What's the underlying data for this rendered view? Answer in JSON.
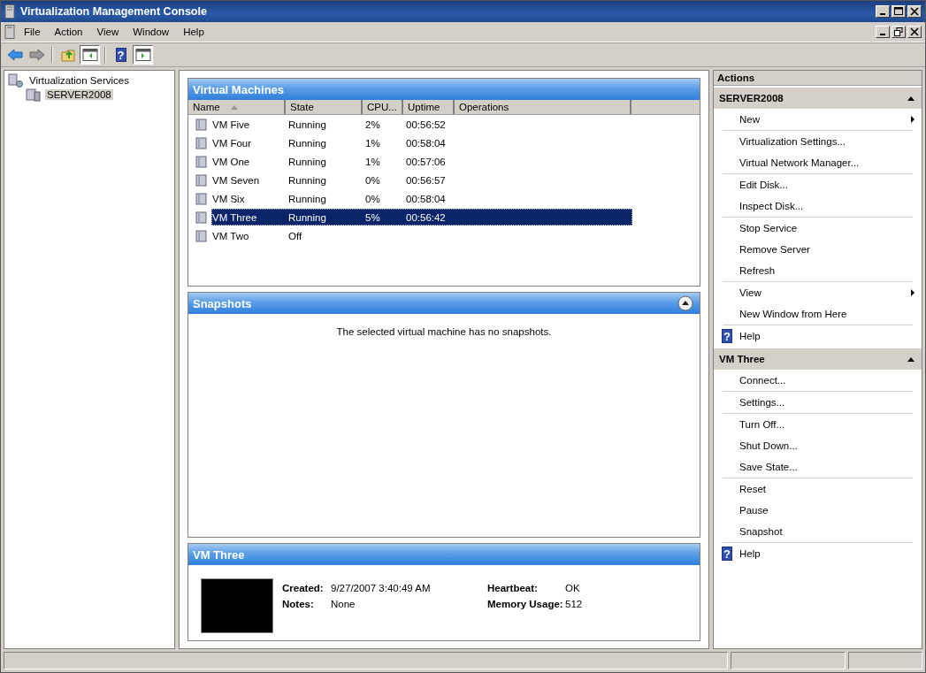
{
  "window": {
    "title": "Virtualization Management Console"
  },
  "menu": [
    {
      "label": "File"
    },
    {
      "label": "Action"
    },
    {
      "label": "View"
    },
    {
      "label": "Window"
    },
    {
      "label": "Help"
    }
  ],
  "toolbar": [
    {
      "kind": "back",
      "pressed": false
    },
    {
      "kind": "forward",
      "pressed": false
    },
    {
      "kind": "separator"
    },
    {
      "kind": "up",
      "pressed": false
    },
    {
      "kind": "tree",
      "pressed": true
    },
    {
      "kind": "separator"
    },
    {
      "kind": "help",
      "pressed": false,
      "glyph": "?"
    },
    {
      "kind": "actionpane",
      "pressed": true
    }
  ],
  "tree": [
    {
      "label": "Virtualization Services",
      "selected": false,
      "children": [
        {
          "label": "SERVER2008",
          "selected": true
        }
      ]
    }
  ],
  "virtual_machines": {
    "title": "Virtual Machines",
    "columns": [
      "Name",
      "State",
      "CPU...",
      "Uptime",
      "Operations"
    ],
    "rows": [
      {
        "name": "VM Five",
        "state": "Running",
        "cpu": "2%",
        "uptime": "00:56:52",
        "selected": false
      },
      {
        "name": "VM Four",
        "state": "Running",
        "cpu": "1%",
        "uptime": "00:58:04",
        "selected": false
      },
      {
        "name": "VM One",
        "state": "Running",
        "cpu": "1%",
        "uptime": "00:57:06",
        "selected": false
      },
      {
        "name": "VM Seven",
        "state": "Running",
        "cpu": "0%",
        "uptime": "00:56:57",
        "selected": false
      },
      {
        "name": "VM Six",
        "state": "Running",
        "cpu": "0%",
        "uptime": "00:58:04",
        "selected": false
      },
      {
        "name": "VM Three",
        "state": "Running",
        "cpu": "5%",
        "uptime": "00:56:42",
        "selected": true
      },
      {
        "name": "VM Two",
        "state": "Off",
        "cpu": "",
        "uptime": "",
        "selected": false
      }
    ]
  },
  "snapshots": {
    "title": "Snapshots",
    "message": "The selected virtual machine has no snapshots."
  },
  "details": {
    "title": "VM Three",
    "fields": [
      {
        "label": "Created:",
        "value": "9/27/2007 3:40:49 AM"
      },
      {
        "label": "Heartbeat:",
        "value": "OK"
      },
      {
        "label": "Notes:",
        "value": "None"
      },
      {
        "label": "Memory Usage:",
        "value": "512"
      }
    ]
  },
  "actions": {
    "title": "Actions",
    "sections": [
      {
        "title": "SERVER2008",
        "expanded": true,
        "groups": [
          [
            {
              "label": "New",
              "kind": "submenu"
            }
          ],
          [
            {
              "label": "Virtualization Settings...",
              "kind": "plain"
            },
            {
              "label": "Virtual Network Manager...",
              "kind": "plain"
            }
          ],
          [
            {
              "label": "Edit Disk...",
              "kind": "plain"
            },
            {
              "label": "Inspect Disk...",
              "kind": "plain"
            }
          ],
          [
            {
              "label": "Stop Service",
              "kind": "plain"
            },
            {
              "label": "Remove Server",
              "kind": "plain"
            },
            {
              "label": "Refresh",
              "kind": "plain"
            }
          ],
          [
            {
              "label": "View",
              "kind": "submenu"
            },
            {
              "label": "New Window from Here",
              "kind": "plain"
            }
          ],
          [
            {
              "label": "Help",
              "kind": "help",
              "glyph": "?"
            }
          ]
        ]
      },
      {
        "title": "VM Three",
        "expanded": true,
        "groups": [
          [
            {
              "label": "Connect...",
              "kind": "plain"
            }
          ],
          [
            {
              "label": "Settings...",
              "kind": "plain"
            }
          ],
          [
            {
              "label": "Turn Off...",
              "kind": "plain"
            },
            {
              "label": "Shut Down...",
              "kind": "plain"
            },
            {
              "label": "Save State...",
              "kind": "plain"
            }
          ],
          [
            {
              "label": "Reset",
              "kind": "plain"
            },
            {
              "label": "Pause",
              "kind": "plain"
            },
            {
              "label": "Snapshot",
              "kind": "plain"
            }
          ],
          [
            {
              "label": "Help",
              "kind": "help",
              "glyph": "?"
            }
          ]
        ]
      }
    ]
  }
}
